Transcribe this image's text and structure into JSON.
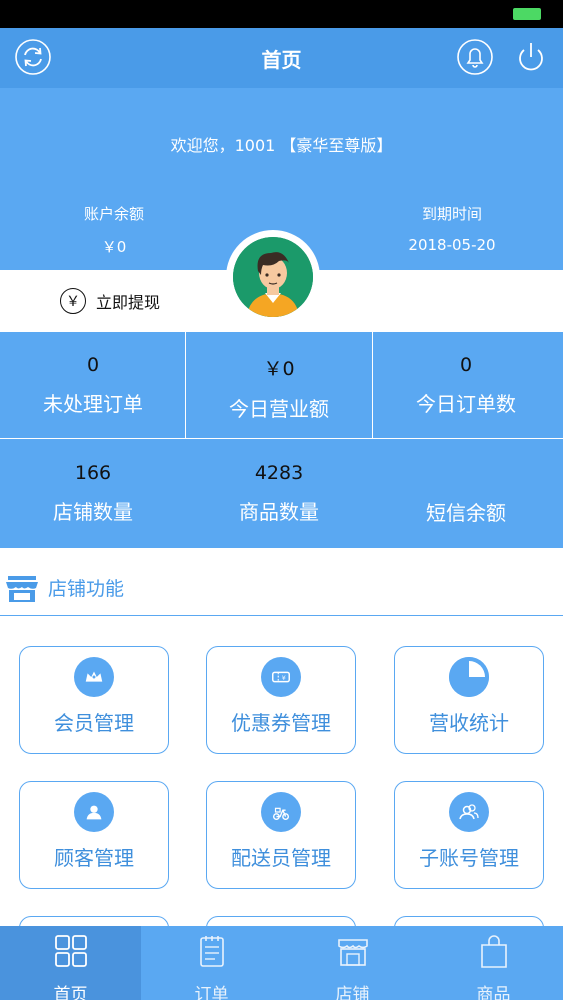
{
  "nav": {
    "title": "首页"
  },
  "hero": {
    "welcome": "欢迎您，1001 【豪华至尊版】",
    "balance_label": "账户余额",
    "balance_value": "￥0",
    "expire_label": "到期时间",
    "expire_value": "2018-05-20"
  },
  "withdraw": {
    "icon_char": "￥",
    "label": "立即提现"
  },
  "stats": [
    {
      "value": "0",
      "label": "未处理订单"
    },
    {
      "value": "￥0",
      "label": "今日营业额"
    },
    {
      "value": "0",
      "label": "今日订单数"
    },
    {
      "value": "166",
      "label": "店铺数量"
    },
    {
      "value": "4283",
      "label": "商品数量"
    },
    {
      "value": "",
      "label": "短信余额"
    }
  ],
  "section": {
    "title": "店铺功能"
  },
  "tiles": [
    {
      "label": "会员管理",
      "icon": "crown-icon"
    },
    {
      "label": "优惠券管理",
      "icon": "coupon-icon"
    },
    {
      "label": "营收统计",
      "icon": "pie-chart-icon"
    },
    {
      "label": "顾客管理",
      "icon": "person-icon"
    },
    {
      "label": "配送员管理",
      "icon": "scooter-icon"
    },
    {
      "label": "子账号管理",
      "icon": "users-icon"
    }
  ],
  "tabs": [
    {
      "label": "首页",
      "icon": "grid-icon",
      "active": true
    },
    {
      "label": "订单",
      "icon": "order-icon",
      "active": false
    },
    {
      "label": "店铺",
      "icon": "store-icon",
      "active": false
    },
    {
      "label": "商品",
      "icon": "bag-icon",
      "active": false
    }
  ],
  "colors": {
    "primary": "#5aa8f2",
    "nav": "#4a9be8",
    "accent_text": "#3f8fdc",
    "battery": "#4cd964"
  }
}
